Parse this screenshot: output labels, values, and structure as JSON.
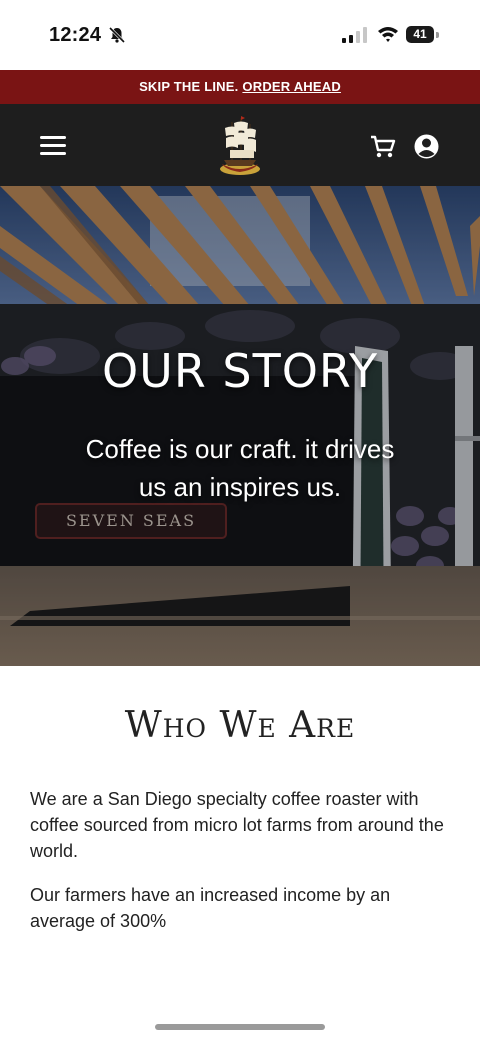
{
  "status": {
    "time": "12:24",
    "battery": "41"
  },
  "promo": {
    "text": "SKIP THE LINE.",
    "link": "ORDER AHEAD"
  },
  "header": {
    "menu_icon": "hamburger-icon",
    "logo": "seven-seas-ship-logo",
    "cart_icon": "cart-icon",
    "account_icon": "user-circle-icon"
  },
  "hero": {
    "title": "OUR STORY",
    "subtitle": "Coffee is our craft. it drives us an inspires us.",
    "sign_text": "SEVEN SEAS"
  },
  "about": {
    "title": "Who We Are",
    "paragraph1": "We are a San Diego specialty coffee roaster with coffee sourced from micro lot farms from around the world.",
    "paragraph2": "Our farmers have an increased income by an average of 300%"
  },
  "colors": {
    "banner": "#7a1414",
    "header": "#1e1e1e"
  }
}
